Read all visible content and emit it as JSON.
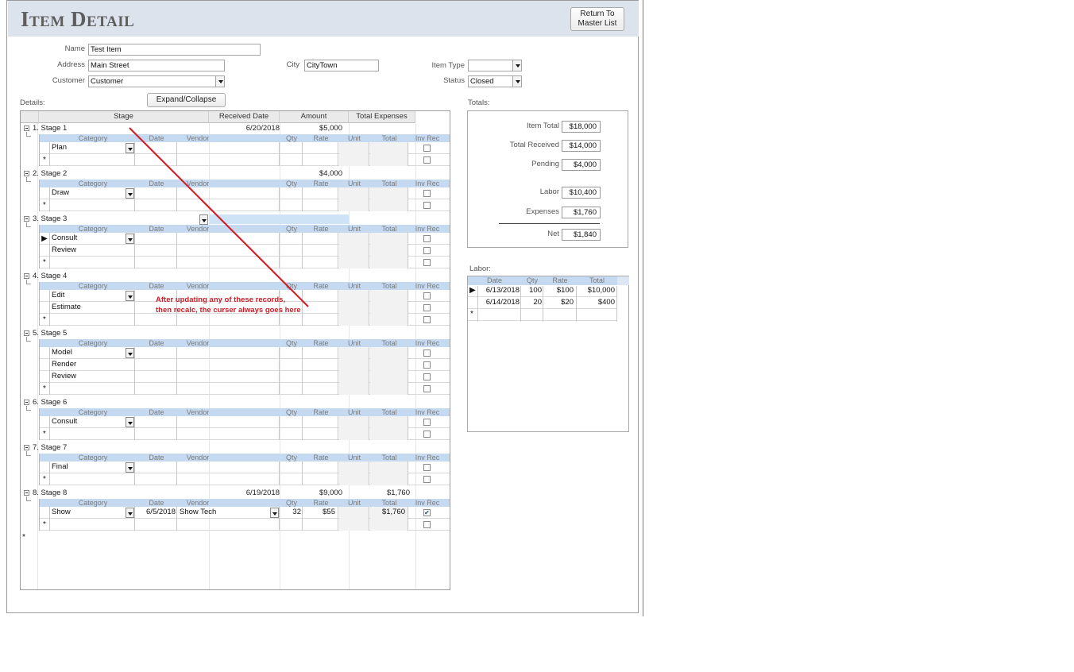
{
  "header": {
    "title": "Item Detail",
    "return_button": "Return To Master List"
  },
  "form": {
    "name_label": "Name",
    "name_value": "Test Item",
    "address_label": "Address",
    "address_value": "Main Street",
    "city_label": "City",
    "city_value": "CityTown",
    "customer_label": "Customer",
    "customer_value": "Customer",
    "item_type_label": "Item Type",
    "item_type_value": "",
    "status_label": "Status",
    "status_value": "Closed"
  },
  "details": {
    "label": "Details:",
    "expand_button": "Expand/Collapse",
    "columns": [
      "Stage",
      "Received Date",
      "Amount",
      "Total Expenses"
    ],
    "sub_columns": [
      "Category",
      "Date",
      "Vendor",
      "Qty",
      "Rate",
      "Unit",
      "Total",
      "Inv Rec"
    ],
    "new_row_marker": "*",
    "current_row_marker": "▶"
  },
  "stages": [
    {
      "name": "1. Stage 1",
      "received": "6/20/2018",
      "amount": "$5,000",
      "expenses": "",
      "rows": [
        {
          "category": "Plan",
          "date": "",
          "vendor": "",
          "qty": "",
          "rate": "",
          "total": "",
          "inv": false,
          "current": false
        }
      ]
    },
    {
      "name": "2. Stage 2",
      "received": "",
      "amount": "$4,000",
      "expenses": "",
      "rows": [
        {
          "category": "Draw",
          "date": "",
          "vendor": "",
          "qty": "",
          "rate": "",
          "total": "",
          "inv": false,
          "current": false
        }
      ]
    },
    {
      "name": "3. Stage 3",
      "received": "",
      "amount": "",
      "expenses": "",
      "rows": [
        {
          "category": "Consult",
          "date": "",
          "vendor": "",
          "qty": "",
          "rate": "",
          "total": "",
          "inv": false,
          "current": true
        },
        {
          "category": "Review",
          "date": "",
          "vendor": "",
          "qty": "",
          "rate": "",
          "total": "",
          "inv": false,
          "current": false
        }
      ]
    },
    {
      "name": "4. Stage 4",
      "received": "",
      "amount": "",
      "expenses": "",
      "rows": [
        {
          "category": "Edit",
          "date": "",
          "vendor": "",
          "qty": "",
          "rate": "",
          "total": "",
          "inv": false,
          "current": false
        },
        {
          "category": "Estimate",
          "date": "",
          "vendor": "",
          "qty": "",
          "rate": "",
          "total": "",
          "inv": false,
          "current": false
        }
      ]
    },
    {
      "name": "5. Stage 5",
      "received": "",
      "amount": "",
      "expenses": "",
      "rows": [
        {
          "category": "Model",
          "date": "",
          "vendor": "",
          "qty": "",
          "rate": "",
          "total": "",
          "inv": false,
          "current": false
        },
        {
          "category": "Render",
          "date": "",
          "vendor": "",
          "qty": "",
          "rate": "",
          "total": "",
          "inv": false,
          "current": false
        },
        {
          "category": "Review",
          "date": "",
          "vendor": "",
          "qty": "",
          "rate": "",
          "total": "",
          "inv": false,
          "current": false
        }
      ]
    },
    {
      "name": "6. Stage 6",
      "received": "",
      "amount": "",
      "expenses": "",
      "rows": [
        {
          "category": "Consult",
          "date": "",
          "vendor": "",
          "qty": "",
          "rate": "",
          "total": "",
          "inv": false,
          "current": false
        }
      ]
    },
    {
      "name": "7. Stage 7",
      "received": "",
      "amount": "",
      "expenses": "",
      "rows": [
        {
          "category": "Final",
          "date": "",
          "vendor": "",
          "qty": "",
          "rate": "",
          "total": "",
          "inv": false,
          "current": false
        }
      ]
    },
    {
      "name": "8. Stage 8",
      "received": "6/19/2018",
      "amount": "$9,000",
      "expenses": "$1,760",
      "rows": [
        {
          "category": "Show",
          "date": "6/5/2018",
          "vendor": "Show Tech",
          "qty": "32",
          "rate": "$55",
          "total": "$1,760",
          "inv": true,
          "current": false
        }
      ]
    }
  ],
  "totals": {
    "label": "Totals:",
    "items": [
      {
        "label": "Item Total",
        "value": "$18,000"
      },
      {
        "label": "Total Received",
        "value": "$14,000"
      },
      {
        "label": "Pending",
        "value": "$4,000"
      },
      {
        "label": "Labor",
        "value": "$10,400"
      },
      {
        "label": "Expenses",
        "value": "$1,760"
      },
      {
        "label": "Net",
        "value": "$1,840"
      }
    ]
  },
  "labor": {
    "label": "Labor:",
    "columns": [
      "Date",
      "Qty",
      "Rate",
      "Total"
    ],
    "rows": [
      {
        "date": "6/13/2018",
        "qty": "100",
        "rate": "$100",
        "total": "$10,000",
        "current": true
      },
      {
        "date": "6/14/2018",
        "qty": "20",
        "rate": "$20",
        "total": "$400",
        "current": false
      }
    ]
  },
  "annotation": {
    "line1": "After updating any of these records,",
    "line2": "then recalc, the curser always goes here",
    "color": "#c8202a"
  }
}
